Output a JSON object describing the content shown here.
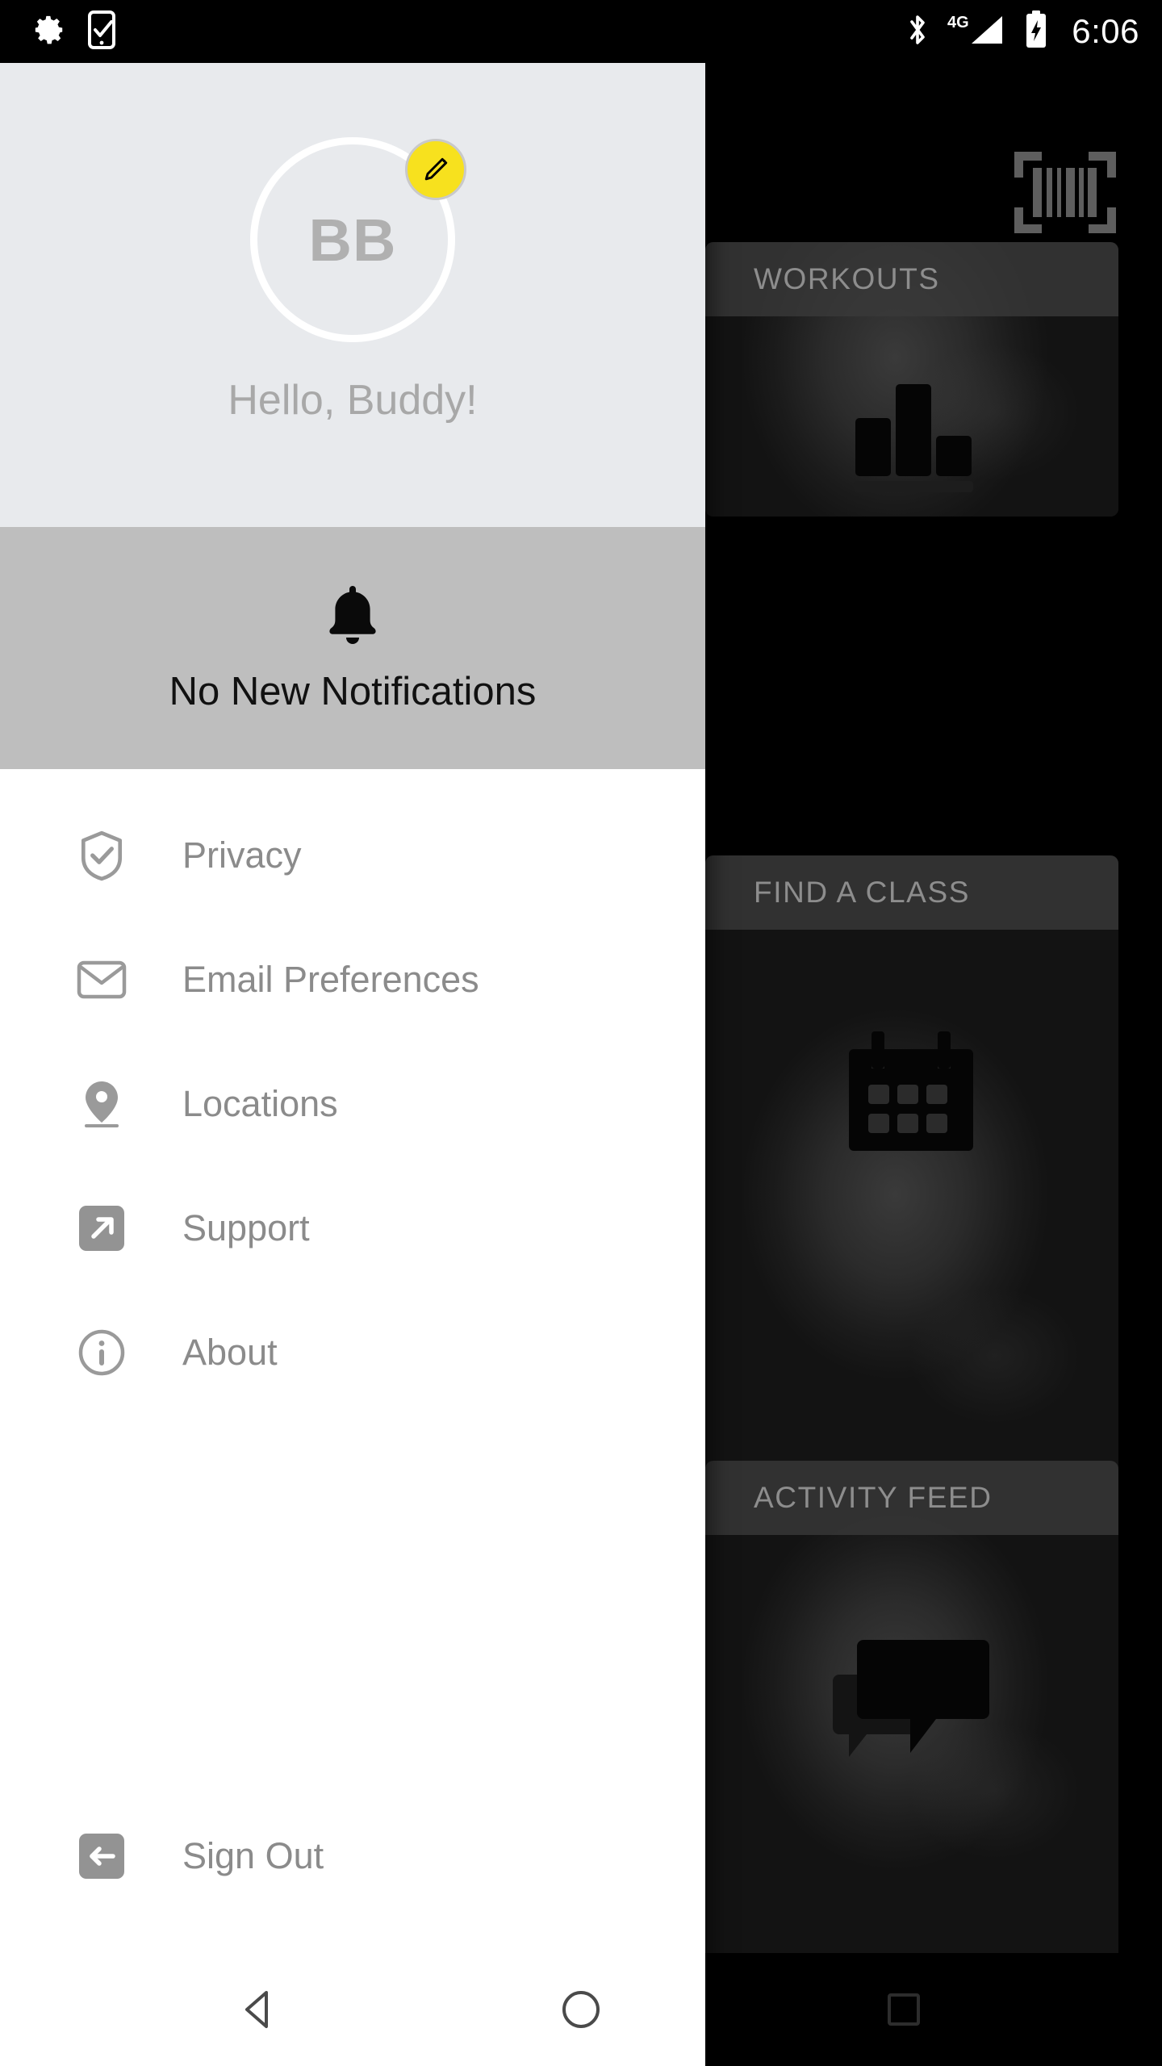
{
  "status_bar": {
    "left_icons": [
      "gear-icon",
      "phone-check-icon"
    ],
    "right_icons": [
      "bluetooth-icon",
      "signal-4g-icon",
      "battery-charging-icon"
    ],
    "network_label": "4G",
    "clock": "6:06"
  },
  "drawer": {
    "profile": {
      "avatar_initials": "BB",
      "greeting": "Hello, Buddy!",
      "edit_badge_icon": "pencil-icon",
      "edit_badge_color": "#f7e11e",
      "background_color": "#e8eaed"
    },
    "notification": {
      "icon": "bell-icon",
      "text": "No New Notifications",
      "background_color": "#bebebe"
    },
    "menu_items": [
      {
        "label": "Privacy",
        "icon": "shield-check-icon"
      },
      {
        "label": "Email Preferences",
        "icon": "envelope-icon"
      },
      {
        "label": "Locations",
        "icon": "map-pin-icon"
      },
      {
        "label": "Support",
        "icon": "external-link-icon"
      },
      {
        "label": "About",
        "icon": "info-circle-icon"
      }
    ],
    "sign_out": {
      "label": "Sign Out",
      "icon": "sign-out-icon"
    }
  },
  "background_app": {
    "header": {
      "scan_icon": "barcode-icon"
    },
    "cards": [
      {
        "title": "WORKOUTS",
        "icon": "bar-chart-icon"
      },
      {
        "title": "FIND A CLASS",
        "icon": "calendar-icon"
      },
      {
        "title": "ACTIVITY FEED",
        "icon": "chat-bubbles-icon"
      }
    ]
  },
  "nav_bar": {
    "back_label": "Back",
    "home_label": "Home",
    "recents_label": "Recents"
  }
}
